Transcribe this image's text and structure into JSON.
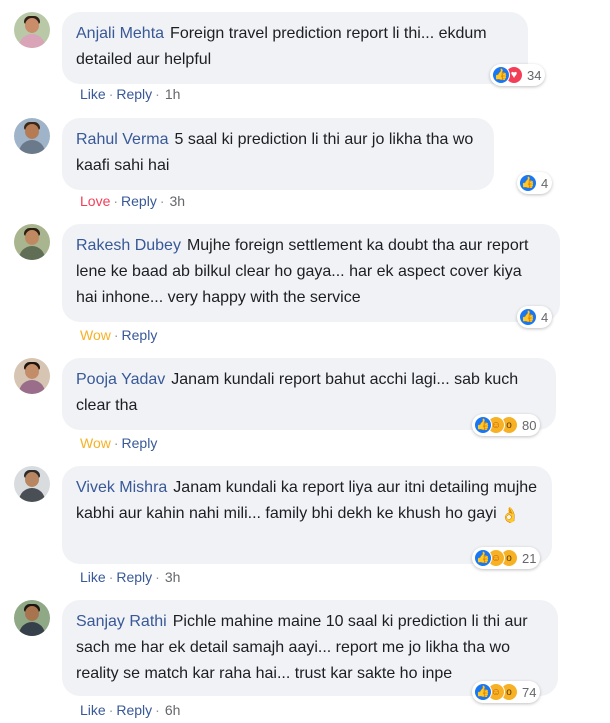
{
  "colors": {
    "link": "#385898",
    "like": "#1877f2",
    "love": "#f33e58",
    "wow": "#f7b125",
    "bubble": "#f0f2f5"
  },
  "comments": [
    {
      "author": "Anjali Mehta",
      "text": "Foreign travel prediction report li thi... ekdum detailed aur helpful",
      "reactions": [
        "like-icon",
        "love-icon"
      ],
      "reaction_count": "34",
      "action": "Like",
      "reply": "Reply",
      "time": "1h"
    },
    {
      "author": "Rahul Verma",
      "text": "5 saal ki prediction li thi aur jo likha tha wo kaafi sahi hai",
      "reactions": [
        "like-icon"
      ],
      "reaction_count": "4",
      "action": "Love",
      "reply": "Reply",
      "time": "3h"
    },
    {
      "author": "Rakesh Dubey",
      "text": "Mujhe foreign settlement ka doubt tha aur report lene ke baad ab bilkul clear ho gaya... har ek aspect cover kiya hai inhone... very happy with the service",
      "reactions": [
        "like-icon"
      ],
      "reaction_count": "4",
      "action": "Wow",
      "reply": "Reply",
      "time": ""
    },
    {
      "author": "Pooja Yadav",
      "text": "Janam kundali report bahut acchi lagi... sab kuch clear tha",
      "reactions": [
        "like-icon",
        "care-icon",
        "wow-icon"
      ],
      "reaction_count": "80",
      "action": "Wow",
      "reply": "Reply",
      "time": ""
    },
    {
      "author": "Vivek Mishra",
      "text": "Janam kundali ka report liya aur itni detailing mujhe kabhi aur kahin nahi mili... family bhi dekh ke khush ho gayi",
      "emoji": "👌",
      "reactions": [
        "like-icon",
        "care-icon",
        "wow-icon"
      ],
      "reaction_count": "21",
      "action": "Like",
      "reply": "Reply",
      "time": "3h"
    },
    {
      "author": "Sanjay Rathi",
      "text": "Pichle mahine maine 10 saal ki prediction li thi aur sach me har ek detail samajh aayi... report me jo likha tha wo reality se match kar raha hai... trust kar sakte ho inpe",
      "reactions": [
        "like-icon",
        "care-icon",
        "wow-icon"
      ],
      "reaction_count": "74",
      "action": "Like",
      "reply": "Reply",
      "time": "6h"
    }
  ]
}
